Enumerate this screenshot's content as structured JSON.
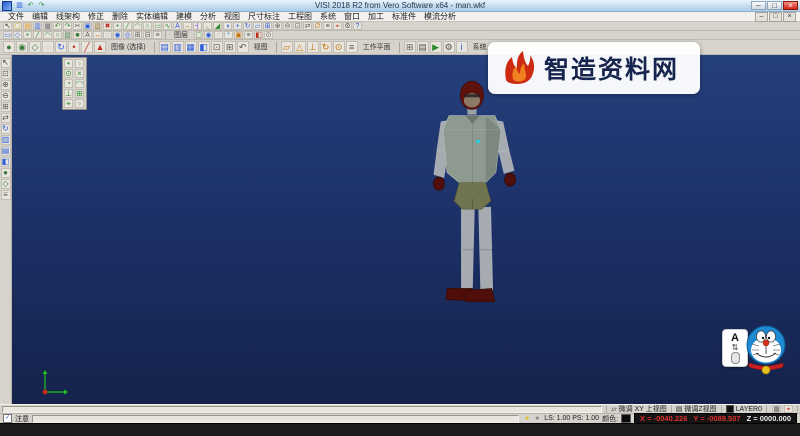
{
  "colors": {
    "viewport_top": "#24407c",
    "viewport_bottom": "#15234c",
    "hair": "#5e120c",
    "face": "#8d7a66",
    "vest": "#8e9a90",
    "limb": "#a6abb1",
    "shorts": "#70744f",
    "shoe": "#4f0e09",
    "accent_cyan": "#19d8e8",
    "watermark_red": "#cc2a12",
    "watermark_text": "#16254d",
    "coord_red": "#e03030"
  },
  "window": {
    "title": "VISI 2018 R2 from Vero Software x64 - man.wkf",
    "controls": {
      "minimize": "–",
      "maximize": "□",
      "close": "×"
    }
  },
  "titlebar": {
    "quick_icons": [
      {
        "name": "quick-save",
        "glyph": "▥",
        "color": "#2a5bd7"
      },
      {
        "name": "quick-undo",
        "glyph": "↶",
        "color": "#2e8b2e"
      },
      {
        "name": "quick-redo",
        "glyph": "↷",
        "color": "#2e8b2e"
      }
    ]
  },
  "menu": {
    "items": [
      "文件",
      "编辑",
      "线架构",
      "修正",
      "删除",
      "实体编辑",
      "建模",
      "分析",
      "视图",
      "尺寸标注",
      "工程图",
      "系统",
      "窗口",
      "加工",
      "标准件",
      "模流分析"
    ]
  },
  "mdi": {
    "minimize": "–",
    "restore": "□",
    "close": "×"
  },
  "toolbar_main": {
    "icons": [
      {
        "name": "select",
        "glyph": "↖",
        "color": "#333333"
      },
      {
        "name": "new-file",
        "glyph": "▢",
        "color": "#d9a400"
      },
      {
        "name": "open-file",
        "glyph": "▤",
        "color": "#d98a00"
      },
      {
        "name": "save",
        "glyph": "▥",
        "color": "#2a5bd7"
      },
      {
        "name": "print",
        "glyph": "▦",
        "color": "#6a6a6a"
      },
      {
        "name": "undo",
        "glyph": "↶",
        "color": "#2e8b2e"
      },
      {
        "name": "redo",
        "glyph": "↷",
        "color": "#2e8b2e"
      },
      {
        "name": "cut",
        "glyph": "✂",
        "color": "#555555"
      },
      {
        "name": "copy",
        "glyph": "▣",
        "color": "#2a5bd7"
      },
      {
        "name": "paste",
        "glyph": "▧",
        "color": "#8a6a2a"
      },
      {
        "name": "delete",
        "glyph": "✖",
        "color": "#c03020"
      },
      {
        "name": "point",
        "glyph": "•",
        "color": "#2e8b2e"
      },
      {
        "name": "line",
        "glyph": "╱",
        "color": "#2e8b2e"
      },
      {
        "name": "arc",
        "glyph": "◠",
        "color": "#2e8b2e"
      },
      {
        "name": "circle",
        "glyph": "○",
        "color": "#2e8b2e"
      },
      {
        "name": "rectangle",
        "glyph": "▭",
        "color": "#2e8b2e"
      },
      {
        "name": "spline",
        "glyph": "∿",
        "color": "#2e8b2e"
      },
      {
        "name": "text",
        "glyph": "A",
        "color": "#2a5bd7"
      },
      {
        "name": "dimension",
        "glyph": "↔",
        "color": "#c07000"
      },
      {
        "name": "trim",
        "glyph": "┤",
        "color": "#8a2be2"
      },
      {
        "name": "fillet",
        "glyph": "◟",
        "color": "#2e8b2e"
      },
      {
        "name": "chamfer",
        "glyph": "◢",
        "color": "#2e8b2e"
      },
      {
        "name": "mirror",
        "glyph": "◑",
        "color": "#2a5bd7"
      },
      {
        "name": "move",
        "glyph": "+",
        "color": "#2a5bd7"
      },
      {
        "name": "rotate",
        "glyph": "↻",
        "color": "#2a5bd7"
      },
      {
        "name": "scale",
        "glyph": "▱",
        "color": "#2a5bd7"
      },
      {
        "name": "array",
        "glyph": "⊞",
        "color": "#2a5bd7"
      },
      {
        "name": "zoom-in",
        "glyph": "⊕",
        "color": "#555555"
      },
      {
        "name": "zoom-out",
        "glyph": "⊖",
        "color": "#555555"
      },
      {
        "name": "zoom-fit",
        "glyph": "⊡",
        "color": "#555555"
      },
      {
        "name": "pan",
        "glyph": "⇄",
        "color": "#555555"
      },
      {
        "name": "measure",
        "glyph": "∅",
        "color": "#c07000"
      },
      {
        "name": "layers",
        "glyph": "≡",
        "color": "#555555"
      },
      {
        "name": "snap",
        "glyph": "⌖",
        "color": "#c03020"
      },
      {
        "name": "settings",
        "glyph": "⚙",
        "color": "#555555"
      },
      {
        "name": "help",
        "glyph": "?",
        "color": "#2a5bd7"
      }
    ]
  },
  "tab_row": {
    "layer_label": "图层",
    "left_icons": [
      {
        "name": "select-window",
        "glyph": "▭",
        "color": "#2a5bd7"
      },
      {
        "name": "select-polygon",
        "glyph": "◇",
        "color": "#2a5bd7"
      },
      {
        "name": "filter-points",
        "glyph": "•",
        "color": "#2e8b2e"
      },
      {
        "name": "filter-lines",
        "glyph": "╱",
        "color": "#2e8b2e"
      },
      {
        "name": "filter-arcs",
        "glyph": "◠",
        "color": "#2e8b2e"
      },
      {
        "name": "filter-circles",
        "glyph": "○",
        "color": "#2e8b2e"
      },
      {
        "name": "filter-surfaces",
        "glyph": "▧",
        "color": "#3a7a3a"
      },
      {
        "name": "filter-solids",
        "glyph": "■",
        "color": "#3a7a3a"
      },
      {
        "name": "filter-text",
        "glyph": "A",
        "color": "#555555"
      },
      {
        "name": "filter-dimensions",
        "glyph": "↔",
        "color": "#c07000"
      },
      {
        "name": "hide-elements",
        "glyph": "◌",
        "color": "#555555"
      },
      {
        "name": "show-elements",
        "glyph": "◉",
        "color": "#2a5bd7"
      },
      {
        "name": "isolate",
        "glyph": "◎",
        "color": "#2a5bd7"
      },
      {
        "name": "group",
        "glyph": "⊞",
        "color": "#555555"
      },
      {
        "name": "ungroup",
        "glyph": "⊟",
        "color": "#555555"
      },
      {
        "name": "attributes",
        "glyph": "≡",
        "color": "#555555"
      }
    ],
    "right_icons": [
      {
        "name": "layer-new",
        "glyph": "▢",
        "color": "#2e8b2e"
      },
      {
        "name": "layer-on",
        "glyph": "◉",
        "color": "#2a5bd7"
      },
      {
        "name": "layer-off",
        "glyph": "◌",
        "color": "#777777"
      },
      {
        "name": "layer-freeze",
        "glyph": "*",
        "color": "#2a9bd7"
      },
      {
        "name": "layer-current",
        "glyph": "▣",
        "color": "#c07000"
      },
      {
        "name": "layer-list",
        "glyph": "≡",
        "color": "#555555"
      },
      {
        "name": "layer-color",
        "glyph": "◧",
        "color": "#c03020"
      },
      {
        "name": "layer-lock",
        "glyph": "⊙",
        "color": "#555555"
      }
    ]
  },
  "toolbar_second": {
    "groups": [
      {
        "label": "图像 (选择)",
        "icons": [
          {
            "name": "shaded-mode",
            "glyph": "●",
            "color": "#3a7a3a"
          },
          {
            "name": "shaded-edges-mode",
            "glyph": "◉",
            "color": "#3a7a3a"
          },
          {
            "name": "wireframe-mode",
            "glyph": "◇",
            "color": "#3a7a3a"
          },
          {
            "name": "hidden-line-mode",
            "glyph": "◌",
            "color": "#777777"
          },
          {
            "name": "dynamic-rotate",
            "glyph": "↻",
            "color": "#2a5bd7"
          },
          {
            "name": "select-vertex",
            "glyph": "•",
            "color": "#c03020"
          },
          {
            "name": "select-edge",
            "glyph": "╱",
            "color": "#c03020"
          },
          {
            "name": "select-face",
            "glyph": "▲",
            "color": "#c03020"
          }
        ]
      },
      {
        "label": "视图",
        "icons": [
          {
            "name": "view-top",
            "glyph": "▤",
            "color": "#2a5bd7"
          },
          {
            "name": "view-front",
            "glyph": "▥",
            "color": "#2a5bd7"
          },
          {
            "name": "view-right",
            "glyph": "▦",
            "color": "#2a5bd7"
          },
          {
            "name": "view-iso",
            "glyph": "◧",
            "color": "#2a5bd7"
          },
          {
            "name": "zoom-window",
            "glyph": "⊡",
            "color": "#555555"
          },
          {
            "name": "zoom-all",
            "glyph": "⊞",
            "color": "#555555"
          },
          {
            "name": "view-previous",
            "glyph": "↶",
            "color": "#555555"
          }
        ]
      },
      {
        "label": "工作平面",
        "icons": [
          {
            "name": "workplane-standard",
            "glyph": "▱",
            "color": "#c07000"
          },
          {
            "name": "workplane-3points",
            "glyph": "△",
            "color": "#c07000"
          },
          {
            "name": "workplane-normal",
            "glyph": "⊥",
            "color": "#c07000"
          },
          {
            "name": "workplane-rotate",
            "glyph": "↻",
            "color": "#c07000"
          },
          {
            "name": "workplane-origin",
            "glyph": "⊙",
            "color": "#c07000"
          },
          {
            "name": "workplane-list",
            "glyph": "≡",
            "color": "#555555"
          }
        ]
      },
      {
        "label": "系统",
        "icons": [
          {
            "name": "calculator",
            "glyph": "⊞",
            "color": "#555555"
          },
          {
            "name": "database",
            "glyph": "▤",
            "color": "#555555"
          },
          {
            "name": "macro-run",
            "glyph": "▶",
            "color": "#2e8b2e"
          },
          {
            "name": "options",
            "glyph": "⚙",
            "color": "#555555"
          },
          {
            "name": "info",
            "glyph": "i",
            "color": "#2a5bd7"
          }
        ]
      }
    ]
  },
  "left_dock": {
    "icons": [
      {
        "name": "select-arrow",
        "glyph": "↖",
        "color": "#333333"
      },
      {
        "name": "dock-zoom-window",
        "glyph": "⊡",
        "color": "#555555"
      },
      {
        "name": "dock-zoom-in",
        "glyph": "⊕",
        "color": "#555555"
      },
      {
        "name": "dock-zoom-out",
        "glyph": "⊖",
        "color": "#555555"
      },
      {
        "name": "dock-zoom-all",
        "glyph": "⊞",
        "color": "#555555"
      },
      {
        "name": "dock-pan",
        "glyph": "⇄",
        "color": "#555555"
      },
      {
        "name": "dock-rotate-view",
        "glyph": "↻",
        "color": "#2a5bd7"
      },
      {
        "name": "dock-view-front",
        "glyph": "▥",
        "color": "#2a5bd7"
      },
      {
        "name": "dock-view-top",
        "glyph": "▤",
        "color": "#2a5bd7"
      },
      {
        "name": "dock-view-iso",
        "glyph": "◧",
        "color": "#2a5bd7"
      },
      {
        "name": "dock-shaded",
        "glyph": "●",
        "color": "#3a7a3a"
      },
      {
        "name": "dock-wireframe",
        "glyph": "◇",
        "color": "#3a7a3a"
      },
      {
        "name": "dock-layer-manager",
        "glyph": "≡",
        "color": "#555555"
      }
    ]
  },
  "palette": {
    "icons": [
      {
        "name": "snap-end",
        "glyph": "•",
        "color": "#2e8b2e"
      },
      {
        "name": "snap-mid",
        "glyph": "◦",
        "color": "#2e8b2e"
      },
      {
        "name": "snap-center",
        "glyph": "⊙",
        "color": "#2e8b2e"
      },
      {
        "name": "snap-intersection",
        "glyph": "×",
        "color": "#2e8b2e"
      },
      {
        "name": "snap-quadrant",
        "glyph": "◔",
        "color": "#2e8b2e"
      },
      {
        "name": "snap-tangent",
        "glyph": "◠",
        "color": "#2e8b2e"
      },
      {
        "name": "snap-perpendicular",
        "glyph": "⊥",
        "color": "#2e8b2e"
      },
      {
        "name": "snap-grid",
        "glyph": "⊞",
        "color": "#2e8b2e"
      },
      {
        "name": "snap-origin",
        "glyph": "⌖",
        "color": "#2e8b2e"
      },
      {
        "name": "snap-point",
        "glyph": "▫",
        "color": "#2e8b2e"
      }
    ]
  },
  "watermark": {
    "text": "智造资料网"
  },
  "overlay_tool": {
    "letter": "A",
    "arrows": "⇅"
  },
  "status_upper": {
    "view_xy": "微调 XY 上视图",
    "view_z": "微调Z视图",
    "layer_label": "LAYER0",
    "icons": [
      {
        "name": "grid-toggle",
        "glyph": "▦",
        "color": "#555555"
      },
      {
        "name": "snap-toggle",
        "glyph": "⌖",
        "color": "#c03020"
      }
    ]
  },
  "status_lower": {
    "note": "注意",
    "icons": [
      {
        "name": "light-on",
        "glyph": "●",
        "color": "#e8c020"
      },
      {
        "name": "light-off",
        "glyph": "●",
        "color": "#8a8a8a"
      }
    ],
    "ls_ps": "LS: 1.00 PS: 1.00",
    "color_label": "颜色:",
    "coord_x": "X = -0040.226",
    "coord_y": "Y = -0089.507",
    "coord_z": "Z = 0000.000"
  }
}
